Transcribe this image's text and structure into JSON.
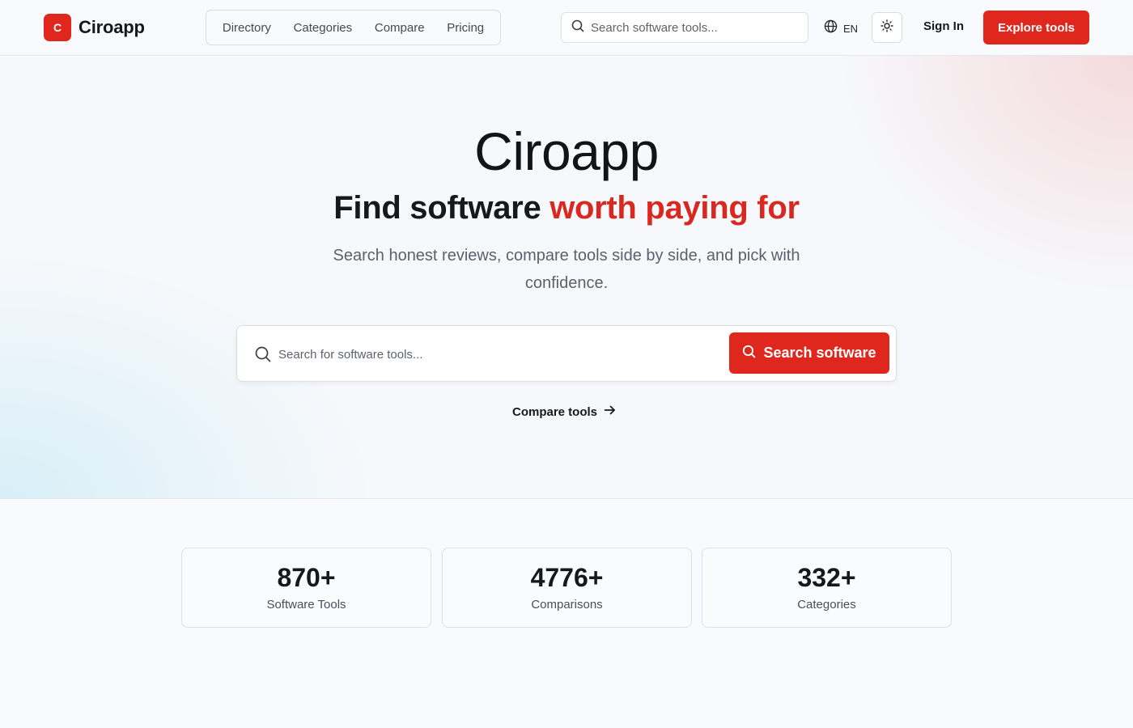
{
  "brand": {
    "logo_letter": "C",
    "name": "Ciroapp",
    "accent_color": "#e0271d"
  },
  "nav": {
    "items": [
      {
        "label": "Directory"
      },
      {
        "label": "Categories"
      },
      {
        "label": "Compare"
      },
      {
        "label": "Pricing"
      }
    ]
  },
  "header": {
    "search_placeholder": "Search software tools...",
    "language": "EN",
    "sign_in": "Sign In",
    "cta": "Explore tools"
  },
  "hero": {
    "title": "Ciroapp",
    "subtitle_plain": "Find software ",
    "subtitle_accent": "worth paying for",
    "description": "Search honest reviews, compare tools side by side, and pick with confidence.",
    "search_placeholder": "Search for software tools...",
    "search_button": "Search software",
    "compare_link": "Compare tools"
  },
  "stats": [
    {
      "value": "870+",
      "label": "Software Tools"
    },
    {
      "value": "4776+",
      "label": "Comparisons"
    },
    {
      "value": "332+",
      "label": "Categories"
    }
  ],
  "icons": [
    "search-icon",
    "globe-icon",
    "sun-icon",
    "arrow-right-icon"
  ]
}
